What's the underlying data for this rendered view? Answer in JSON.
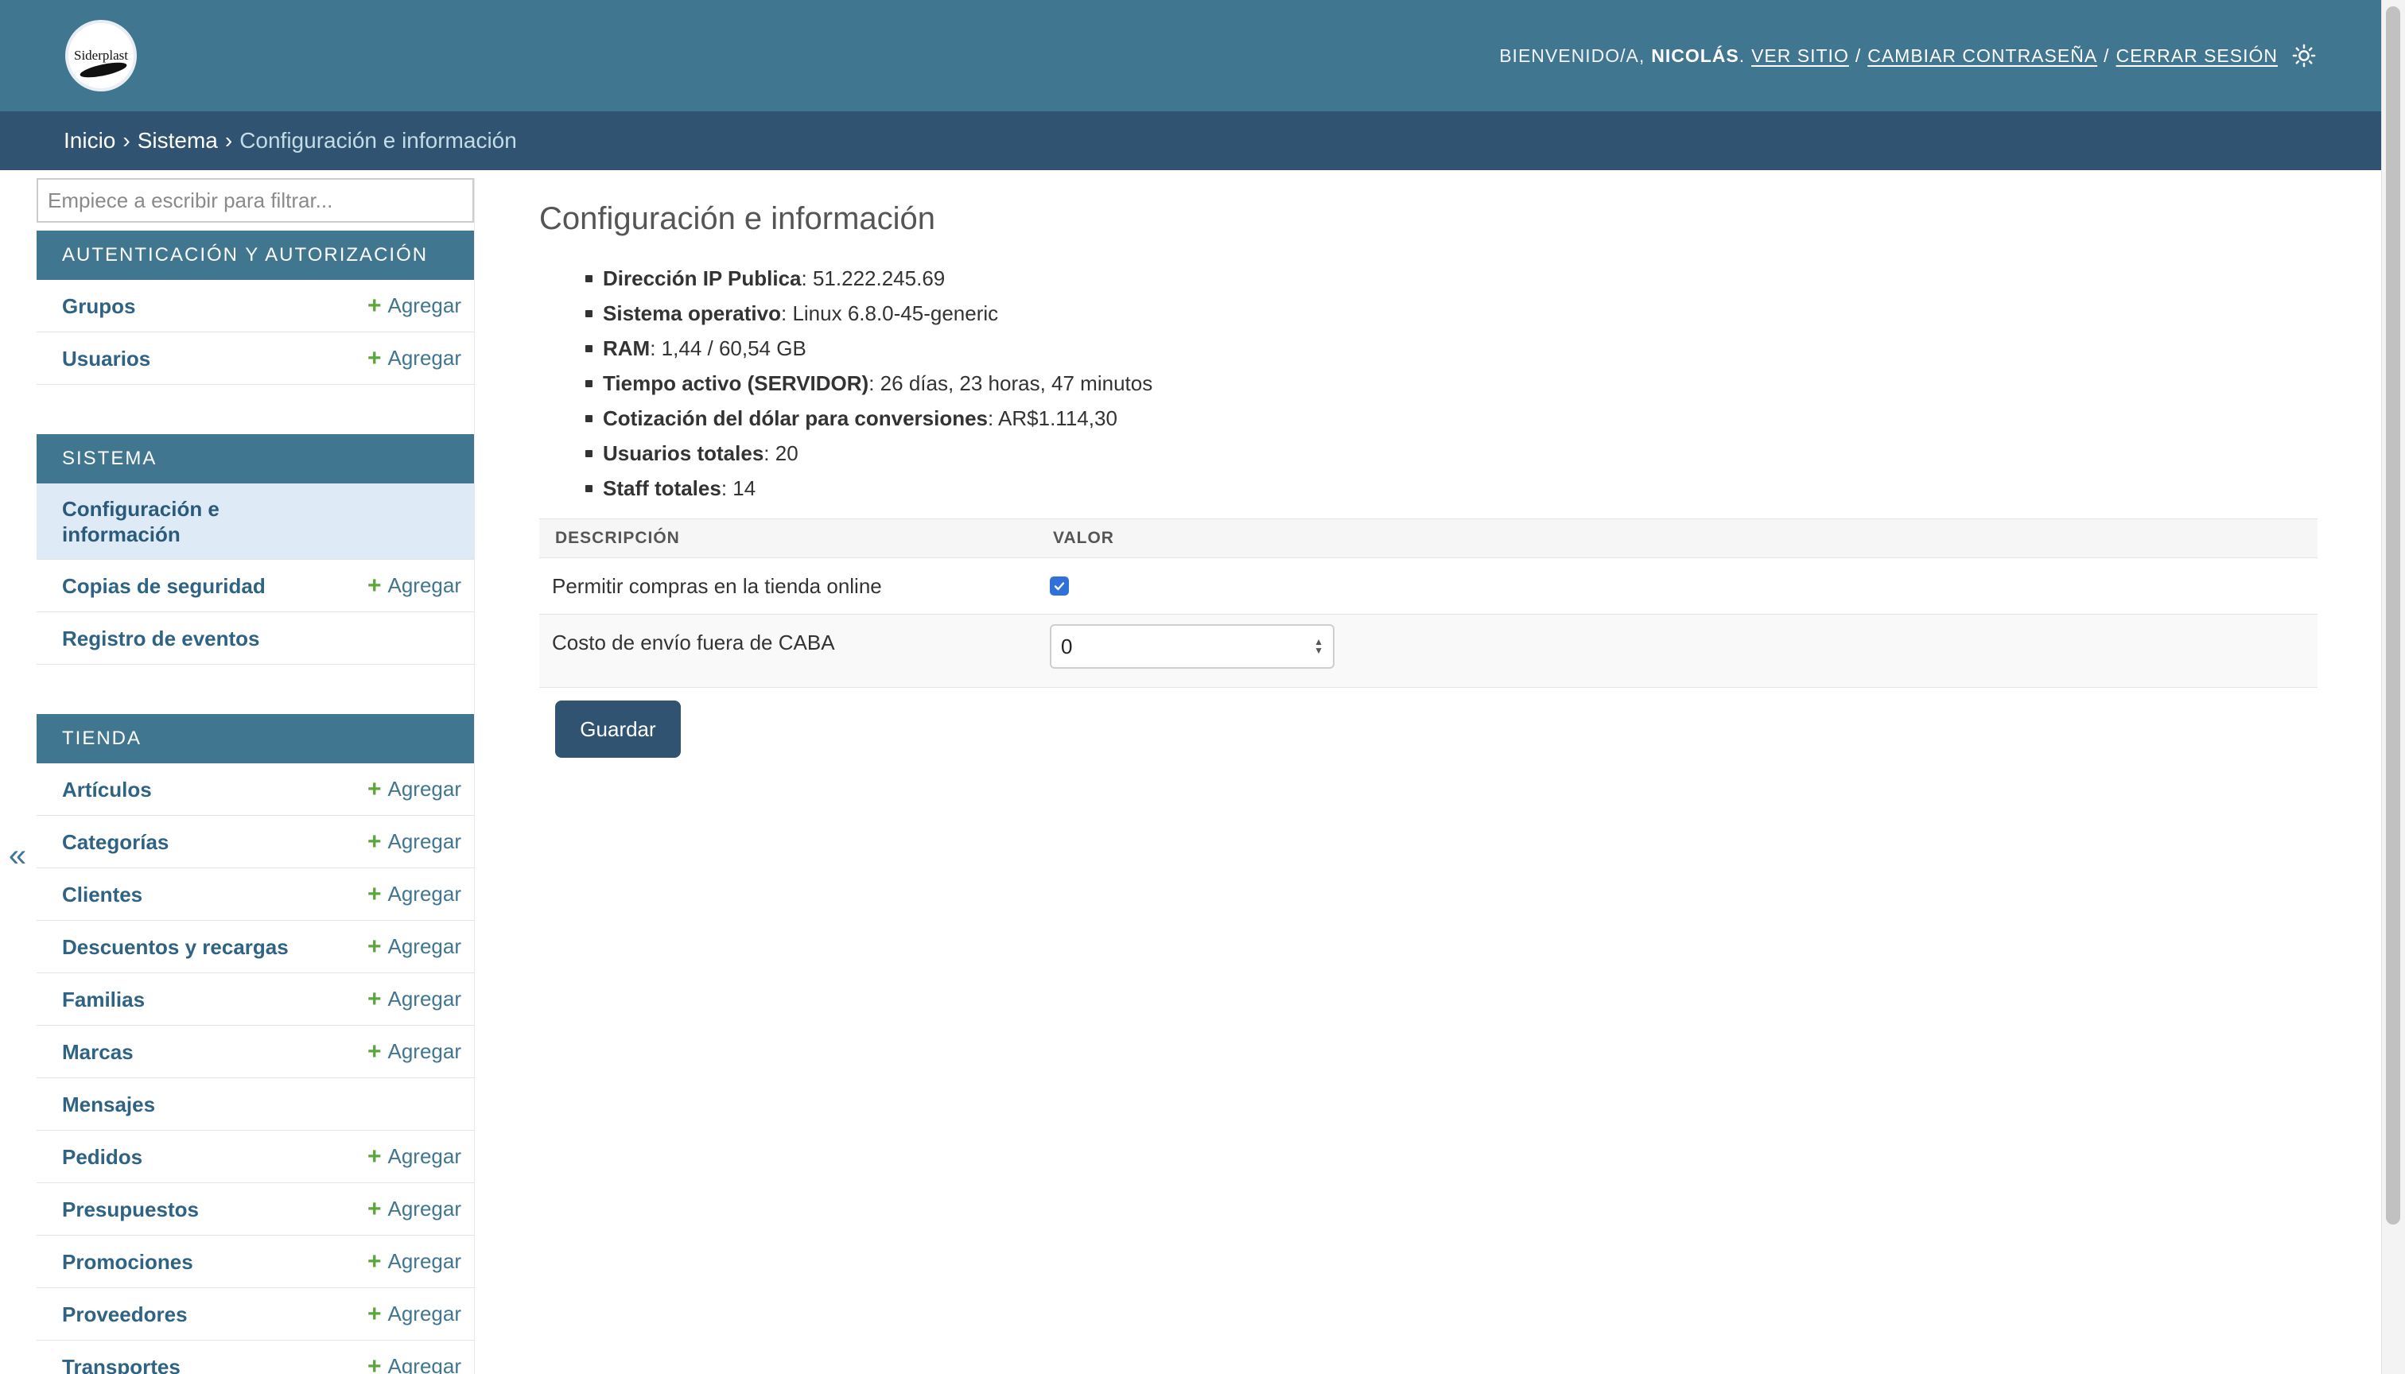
{
  "header": {
    "logo_text": "Siderplast",
    "welcome": "Bienvenido/a,",
    "user_name": "Nicolás",
    "dot": ".",
    "view_site": "Ver sitio",
    "change_password": "Cambiar contraseña",
    "logout": "Cerrar sesión",
    "separator": "/",
    "theme_icon": "sun-icon"
  },
  "breadcrumbs": {
    "home": "Inicio",
    "section": "Sistema",
    "current": "Configuración e información",
    "separator": "›"
  },
  "sidebar": {
    "filter_placeholder": "Empiece a escribir para filtrar...",
    "add_label": "Agregar",
    "toggle_icon": "«",
    "modules": [
      {
        "caption": "Autenticación y autorización",
        "items": [
          {
            "label": "Grupos",
            "add": true
          },
          {
            "label": "Usuarios",
            "add": true
          }
        ]
      },
      {
        "caption": "Sistema",
        "items": [
          {
            "label": "Configuración e información",
            "add": false,
            "selected": true
          },
          {
            "label": "Copias de seguridad",
            "add": true
          },
          {
            "label": "Registro de eventos",
            "add": false
          }
        ]
      },
      {
        "caption": "Tienda",
        "items": [
          {
            "label": "Artículos",
            "add": true
          },
          {
            "label": "Categorías",
            "add": true
          },
          {
            "label": "Clientes",
            "add": true
          },
          {
            "label": "Descuentos y recargas",
            "add": true
          },
          {
            "label": "Familias",
            "add": true
          },
          {
            "label": "Marcas",
            "add": true
          },
          {
            "label": "Mensajes",
            "add": false
          },
          {
            "label": "Pedidos",
            "add": true
          },
          {
            "label": "Presupuestos",
            "add": true
          },
          {
            "label": "Promociones",
            "add": true
          },
          {
            "label": "Proveedores",
            "add": true
          },
          {
            "label": "Transportes",
            "add": true
          }
        ]
      }
    ]
  },
  "main": {
    "title": "Configuración e información",
    "info": [
      {
        "label": "Dirección IP Publica",
        "value": "51.222.245.69"
      },
      {
        "label": "Sistema operativo",
        "value": "Linux 6.8.0-45-generic"
      },
      {
        "label": "RAM",
        "value": "1,44 / 60,54 GB"
      },
      {
        "label": "Tiempo activo (SERVIDOR)",
        "value": "26 días, 23 horas, 47 minutos"
      },
      {
        "label": "Cotización del dólar para conversiones",
        "value": "AR$1.114,30"
      },
      {
        "label": "Usuarios totales",
        "value": "20"
      },
      {
        "label": "Staff totales",
        "value": "14"
      }
    ],
    "table": {
      "col_description": "DESCRIPCIÓN",
      "col_value": "VALOR",
      "row1_label": "Permitir compras en la tienda online",
      "row1_checked": true,
      "row2_label": "Costo de envío fuera de CABA",
      "row2_value": "0"
    },
    "save_label": "Guardar"
  },
  "colors": {
    "header": "#417690",
    "breadcrumbs": "#2f5370",
    "selected_row": "#deebf6",
    "add_plus": "#5ba53d"
  }
}
